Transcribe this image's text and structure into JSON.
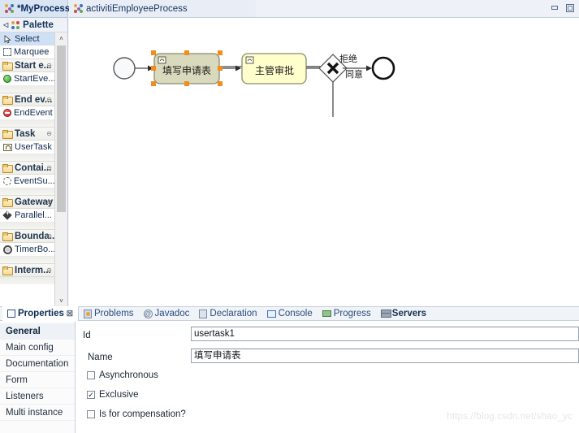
{
  "window": {
    "minimize_label": "Minimize",
    "maximize_label": "Maximize"
  },
  "tabs": {
    "left_tab": {
      "label": "*MyProcess",
      "icon": "activiti-icon",
      "close": "☒"
    },
    "editor_tab": {
      "label": "activitiEmployeeProcess",
      "icon": "activiti-icon"
    }
  },
  "palette": {
    "header": {
      "label": "Palette",
      "collapse_arrow": "◁",
      "icon": "palette-icon"
    },
    "tools": [
      {
        "label": "Select",
        "icon": "cursor-icon",
        "selected": true
      },
      {
        "label": "Marquee",
        "icon": "marquee-icon",
        "selected": false
      }
    ],
    "groups": [
      {
        "label": "Start e...",
        "icon": "folder-icon",
        "collapse": "⊖",
        "items": [
          {
            "label": "StartEve...",
            "icon": "green-circle-icon"
          }
        ]
      },
      {
        "label": "End ev...",
        "icon": "folder-icon",
        "collapse": "⊖",
        "items": [
          {
            "label": "EndEvent",
            "icon": "red-circle-icon"
          }
        ]
      },
      {
        "label": "Task",
        "icon": "folder-icon",
        "collapse": "⊖",
        "items": [
          {
            "label": "UserTask",
            "icon": "usertask-icon"
          }
        ]
      },
      {
        "label": "Contai...",
        "icon": "folder-icon",
        "collapse": "⊖",
        "items": [
          {
            "label": "EventSu...",
            "icon": "dashed-circle-icon"
          }
        ]
      },
      {
        "label": "Gateway",
        "icon": "folder-icon",
        "collapse": "⊖",
        "items": [
          {
            "label": "Parallel...",
            "icon": "gateway-icon"
          }
        ]
      },
      {
        "label": "Bounda...",
        "icon": "folder-icon",
        "collapse": "⊖",
        "items": [
          {
            "label": "TimerBo...",
            "icon": "timer-icon"
          }
        ]
      },
      {
        "label": "Interm...",
        "icon": "folder-icon",
        "collapse": "⊖",
        "items": []
      }
    ],
    "scrollbar": {
      "up_arrow": "˄",
      "down_arrow": "˅"
    }
  },
  "diagram": {
    "type": "bpmn-process",
    "start_event": {
      "name": "start-event"
    },
    "tasks": [
      {
        "id": "usertask1",
        "label": "填写申请表",
        "selected": true,
        "marker": "user-task-marker"
      },
      {
        "id": "usertask2",
        "label": "主管审批",
        "selected": false,
        "marker": "user-task-marker"
      }
    ],
    "gateway": {
      "type": "exclusive-gateway",
      "glyph": "✕"
    },
    "flow_labels": [
      {
        "label": "拒绝"
      },
      {
        "label": "同意"
      }
    ],
    "end_event": {
      "name": "end-event"
    }
  },
  "properties_view": {
    "tabs": [
      {
        "label": "Properties",
        "icon": "properties-icon",
        "active": true,
        "close": "☒"
      },
      {
        "label": "Problems",
        "icon": "problems-icon",
        "active": false
      },
      {
        "label": "Javadoc",
        "icon": "javadoc-icon",
        "active": false
      },
      {
        "label": "Declaration",
        "icon": "declaration-icon",
        "active": false
      },
      {
        "label": "Console",
        "icon": "console-icon",
        "active": false
      },
      {
        "label": "Progress",
        "icon": "progress-icon",
        "active": false
      },
      {
        "label": "Servers",
        "icon": "servers-icon",
        "active": false,
        "bold": true
      }
    ],
    "sections": [
      {
        "label": "General",
        "active": true
      },
      {
        "label": "Main config",
        "active": false
      },
      {
        "label": "Documentation",
        "active": false
      },
      {
        "label": "Form",
        "active": false
      },
      {
        "label": "Listeners",
        "active": false
      },
      {
        "label": "Multi instance",
        "active": false
      }
    ],
    "fields": {
      "id": {
        "label": "Id",
        "value": "usertask1"
      },
      "name": {
        "label": "Name",
        "value": "填写申请表"
      }
    },
    "checkboxes": [
      {
        "label": "Asynchronous",
        "checked": false
      },
      {
        "label": "Exclusive",
        "checked": true
      },
      {
        "label": "Is for compensation?",
        "checked": false
      }
    ]
  },
  "watermark": {
    "text": "https://blog.csdn.net/shao_yc"
  }
}
